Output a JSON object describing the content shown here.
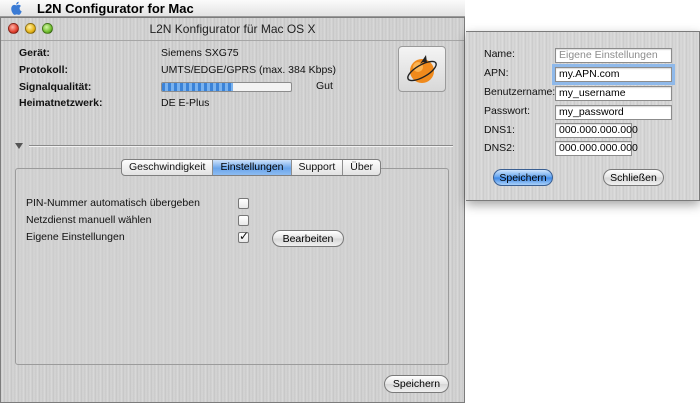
{
  "menubar": {
    "app_name": "L2N Configurator for Mac"
  },
  "window": {
    "title": "L2N Konfigurator für Mac OS X"
  },
  "info": [
    {
      "label": "Gerät:",
      "value": "Siemens SXG75"
    },
    {
      "label": "Protokoll:",
      "value": "UMTS/EDGE/GPRS (max. 384 Kbps)"
    },
    {
      "label": "Signalqualität:",
      "value": "Gut"
    },
    {
      "label": "Heimatnetzwerk:",
      "value": "DE E-Plus"
    }
  ],
  "signal": {
    "level": 0.55
  },
  "tabs": [
    {
      "label": "Geschwindigkeit"
    },
    {
      "label": "Einstellungen"
    },
    {
      "label": "Support"
    },
    {
      "label": "Über"
    }
  ],
  "active_tab": "Einstellungen",
  "options": [
    {
      "label": "PIN-Nummer automatisch übergeben",
      "checked": false
    },
    {
      "label": "Netzdienst manuell wählen",
      "checked": false
    },
    {
      "label": "Eigene Einstellungen",
      "checked": true
    }
  ],
  "buttons": {
    "edit": "Bearbeiten",
    "save": "Speichern"
  },
  "dialog": {
    "fields": [
      {
        "label": "Name:",
        "value": "",
        "placeholder": "Eigene Einstellungen"
      },
      {
        "label": "APN:",
        "value": "my.APN.com"
      },
      {
        "label": "Benutzername:",
        "value": "my_username"
      },
      {
        "label": "Passwort:",
        "value": "my_password"
      },
      {
        "label": "DNS1:",
        "value": "000.000.000.000"
      },
      {
        "label": "DNS2:",
        "value": "000.000.000.000"
      }
    ],
    "save_label": "Speichern",
    "close_label": "Schließen"
  },
  "colors": {
    "accent": "#3a86e6",
    "logo_orange": "#f08a1c"
  }
}
